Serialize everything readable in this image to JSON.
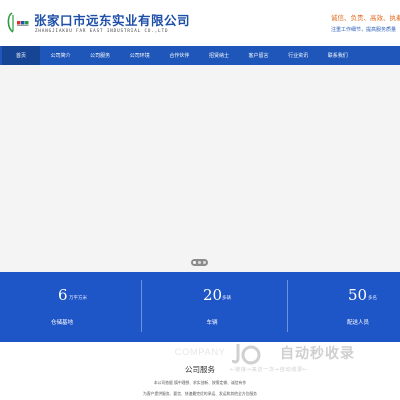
{
  "header": {
    "company_name": "张家口市远东实业有限公司",
    "company_name_en": "ZHANGJIAKOU FAR EAST INDUSTRIAL CO.,LTD",
    "slogan": "诚信、负责、高效、执着、",
    "slogan_sub": "注重工作细节，提高服务质量"
  },
  "nav": {
    "items": [
      {
        "label": "首页",
        "active": true
      },
      {
        "label": "公司简介"
      },
      {
        "label": "公司服务"
      },
      {
        "label": "公司环境"
      },
      {
        "label": "合作伙伴"
      },
      {
        "label": "招贤纳士"
      },
      {
        "label": "客户留言"
      },
      {
        "label": "行业资讯"
      },
      {
        "label": "联系我们"
      }
    ]
  },
  "stats": [
    {
      "value": "6",
      "unit": "万平方米",
      "label": "仓储基地"
    },
    {
      "value": "20",
      "unit": "多辆",
      "label": "车辆"
    },
    {
      "value": "50",
      "unit": "多名",
      "label": "配送人员"
    }
  ],
  "services": {
    "title_en": "COMPANY",
    "title_cn": "公司服务",
    "desc_line1": "本公司依据 慎中理想、求实创新、按需定做、诚信有作",
    "desc_line2": "为客户提供服务、要信、快速最完优的承运、发运和其他全方位服务"
  },
  "watermark": {
    "main": "自动秒收录",
    "sub": "←链接→来访一次→自动收录←"
  },
  "colors": {
    "brand_blue": "#1f56b9",
    "stats_blue": "#1f56c7",
    "slogan_orange": "#e06a1b"
  }
}
